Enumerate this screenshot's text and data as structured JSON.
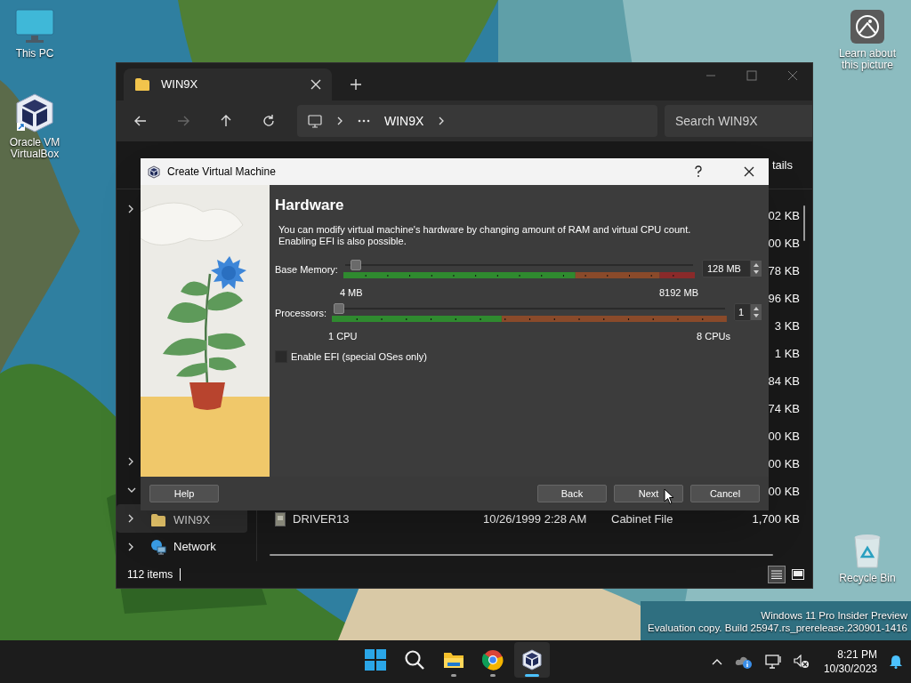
{
  "desktop": {
    "icons": [
      {
        "kind": "pc",
        "label": "This PC"
      },
      {
        "kind": "vbox",
        "label": "Oracle VM VirtualBox"
      },
      {
        "kind": "learn",
        "label": "Learn about this picture"
      },
      {
        "kind": "bin",
        "label": "Recycle Bin"
      }
    ],
    "build_info": [
      "Windows 11 Pro Insider Preview",
      "Evaluation copy. Build 25947.rs_prerelease.230901-1416"
    ]
  },
  "explorer": {
    "tab": {
      "title": "WIN9X",
      "selected": true
    },
    "address": [
      "WIN9X"
    ],
    "search": {
      "placeholder": "Search WIN9X"
    },
    "toolbar_partial": "tails",
    "sidebar": [
      {
        "expanded": false
      },
      {
        "expanded": false
      },
      {
        "expanded": true
      },
      {
        "label": "WIN9X",
        "kind": "folder",
        "expanded": false,
        "selected": true
      },
      {
        "label": "Network",
        "kind": "network",
        "expanded": false,
        "selected": false
      }
    ],
    "partial_sizes": [
      "02 KB",
      "00 KB",
      "78 KB",
      "96 KB",
      "3 KB",
      "1 KB",
      "84 KB",
      "74 KB",
      "00 KB",
      "00 KB",
      "00 KB"
    ],
    "rows": [
      {
        "name": "DRIVER13",
        "date": "10/26/1999 2:28 AM",
        "type": "Cabinet File",
        "size": "1,700 KB"
      }
    ],
    "status": "112 items"
  },
  "dialog": {
    "title": "Create Virtual Machine",
    "heading": "Hardware",
    "description": [
      "You can modify virtual machine's hardware by changing amount of RAM and virtual CPU count.",
      "Enabling EFI is also possible."
    ],
    "settings": [
      {
        "kind": "slider",
        "label": "Base Memory:",
        "level": 0.015,
        "value": "128 MB",
        "min_label": "4 MB",
        "max_label": "8192 MB"
      },
      {
        "kind": "slider",
        "label": "Processors:",
        "level": 0,
        "value": "1",
        "min_label": "1 CPU",
        "max_label": "8 CPUs"
      },
      {
        "kind": "checkbox",
        "label": "Enable EFI (special OSes only)",
        "checked": false
      }
    ],
    "buttons": [
      "Help",
      "Back",
      "Next",
      "Cancel"
    ]
  },
  "taskbar": {
    "apps": [
      {
        "kind": "start",
        "running": false,
        "active": false
      },
      {
        "kind": "search",
        "running": false,
        "active": false
      },
      {
        "kind": "explorer",
        "running": true,
        "active": false
      },
      {
        "kind": "chrome",
        "running": true,
        "active": false
      },
      {
        "kind": "vbox",
        "running": true,
        "active": true
      }
    ],
    "time": "8:21 PM",
    "date": "10/30/2023"
  }
}
